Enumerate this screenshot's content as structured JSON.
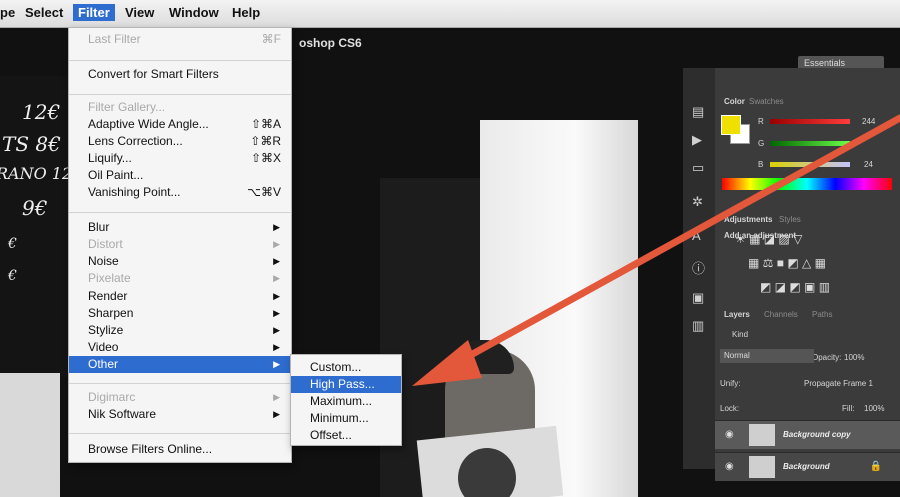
{
  "menubar": {
    "items": [
      "pe",
      "Select",
      "Filter",
      "View",
      "Window",
      "Help"
    ],
    "active": "Filter"
  },
  "app": {
    "title": "oshop CS6",
    "workspace": "Essentials"
  },
  "filter_menu": {
    "last_filter": "Last Filter",
    "last_filter_shortcut": "⌘F",
    "convert": "Convert for Smart Filters",
    "gallery": "Filter Gallery...",
    "items1": [
      {
        "label": "Adaptive Wide Angle...",
        "shortcut": "⇧⌘A"
      },
      {
        "label": "Lens Correction...",
        "shortcut": "⇧⌘R"
      },
      {
        "label": "Liquify...",
        "shortcut": "⇧⌘X"
      },
      {
        "label": "Oil Paint...",
        "shortcut": ""
      },
      {
        "label": "Vanishing Point...",
        "shortcut": "⌥⌘V"
      }
    ],
    "submenus": [
      {
        "label": "Blur",
        "enabled": true
      },
      {
        "label": "Distort",
        "enabled": false
      },
      {
        "label": "Noise",
        "enabled": true
      },
      {
        "label": "Pixelate",
        "enabled": false
      },
      {
        "label": "Render",
        "enabled": true
      },
      {
        "label": "Sharpen",
        "enabled": true
      },
      {
        "label": "Stylize",
        "enabled": true
      },
      {
        "label": "Video",
        "enabled": true
      },
      {
        "label": "Other",
        "enabled": true
      }
    ],
    "plugins": [
      {
        "label": "Digimarc",
        "enabled": false
      },
      {
        "label": "Nik Software",
        "enabled": true
      }
    ],
    "browse": "Browse Filters Online..."
  },
  "other_submenu": {
    "items": [
      "Custom...",
      "High Pass...",
      "Maximum...",
      "Minimum...",
      "Offset..."
    ],
    "highlighted": "High Pass..."
  },
  "chalkboard": [
    "12€",
    "TS 8€",
    "RANO 12",
    "9€",
    "€",
    "€"
  ],
  "panels": {
    "color_tab": "Color",
    "swatches_tab": "Swatches",
    "channels": [
      "R",
      "G",
      "B"
    ],
    "r_value": "244",
    "b_value": "24",
    "adjustments_tab": "Adjustments",
    "styles_tab": "Styles",
    "add_adjustment": "Add an adjustment",
    "layers_tab": "Layers",
    "channels_tab": "Channels",
    "paths_tab": "Paths",
    "kind": "Kind",
    "blend_mode": "Normal",
    "opacity_label": "Opacity:",
    "opacity_value": "100%",
    "unify_label": "Unify:",
    "propagate": "Propagate Frame 1",
    "lock_label": "Lock:",
    "fill_label": "Fill:",
    "fill_value": "100%",
    "layers": [
      {
        "name": "Background copy",
        "selected": true
      },
      {
        "name": "Background",
        "selected": false
      }
    ]
  },
  "colors": {
    "highlight": "#2f6ccf",
    "arrow": "#e3573a",
    "fg_swatch": "#f0e000"
  }
}
